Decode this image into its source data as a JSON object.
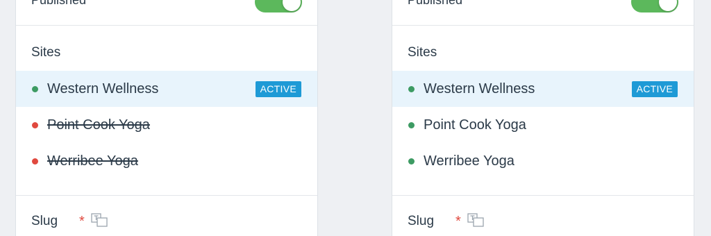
{
  "colors": {
    "toggle_on": "#5cb85c",
    "status_live": "#3d9b63",
    "status_disabled": "#e0493f",
    "badge_active": "#1e9ad6",
    "active_row_bg": "#e8f4fc",
    "required": "#e0493f"
  },
  "panels": [
    {
      "published_label": "Published",
      "published_on": true,
      "sites_heading": "Sites",
      "sites": [
        {
          "name": "Western Wellness",
          "status": "enabled",
          "badge": "ACTIVE"
        },
        {
          "name": "Point Cook Yoga",
          "status": "disabled",
          "badge": ""
        },
        {
          "name": "Werribee Yoga",
          "status": "disabled",
          "badge": ""
        }
      ],
      "slug_label": "Slug",
      "slug_required": "*",
      "translate_icon": "translate-icon"
    },
    {
      "published_label": "Published",
      "published_on": true,
      "sites_heading": "Sites",
      "sites": [
        {
          "name": "Western Wellness",
          "status": "enabled",
          "badge": "ACTIVE"
        },
        {
          "name": "Point Cook Yoga",
          "status": "enabled",
          "badge": ""
        },
        {
          "name": "Werribee Yoga",
          "status": "enabled",
          "badge": ""
        }
      ],
      "slug_label": "Slug",
      "slug_required": "*",
      "translate_icon": "translate-icon"
    }
  ]
}
